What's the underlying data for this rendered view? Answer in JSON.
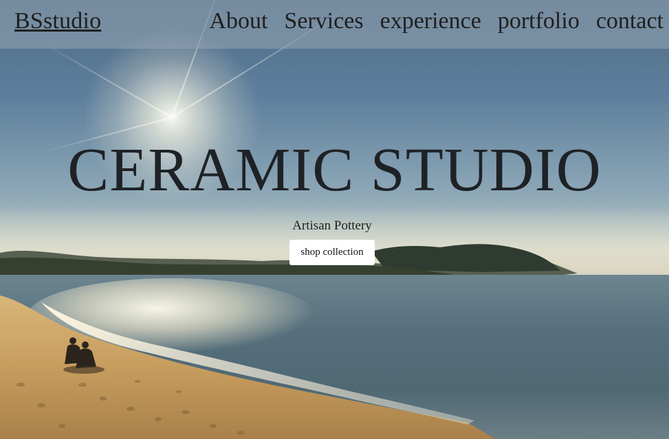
{
  "nav": {
    "brand": "BSstudio",
    "links": [
      "About",
      "Services",
      "experience",
      "portfolio",
      "contact"
    ]
  },
  "hero": {
    "title": "CERAMIC STUDIO",
    "subtitle": "Artisan Pottery",
    "cta_label": "shop collection"
  },
  "colors": {
    "nav_overlay": "#96a5b4",
    "title_text": "#1e2226",
    "button_bg": "#ffffff"
  }
}
